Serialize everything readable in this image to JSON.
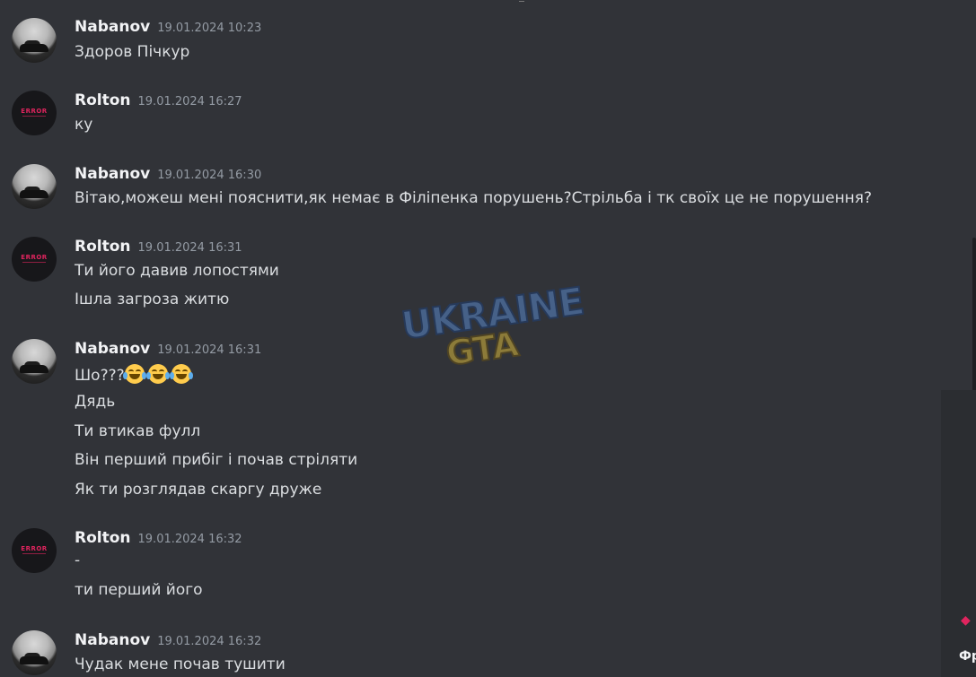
{
  "messages": [
    {
      "user": "Nabanov",
      "avatar": "car-photo",
      "time": "19.01.2024 10:23",
      "lines": [
        "Здоров Пічкур"
      ]
    },
    {
      "user": "Rolton",
      "avatar": "error-logo",
      "time": "19.01.2024 16:27",
      "lines": [
        "ку"
      ]
    },
    {
      "user": "Nabanov",
      "avatar": "car-photo",
      "time": "19.01.2024 16:30",
      "lines": [
        "Вітаю,можеш мені пояснити,як немає в Філіпенка порушень?Стрільба і тк своїх це не порушення?"
      ]
    },
    {
      "user": "Rolton",
      "avatar": "error-logo",
      "time": "19.01.2024 16:31",
      "lines": [
        "Ти його давив лопостями",
        "Ішла загроза житю"
      ]
    },
    {
      "user": "Nabanov",
      "avatar": "car-photo",
      "time": "19.01.2024 16:31",
      "lines": [
        "Шо???",
        "Дядь",
        "Ти втикав фулл",
        "Він перший прибіг і почав стріляти",
        "Як ти розглядав скаргу друже"
      ]
    },
    {
      "user": "Rolton",
      "avatar": "error-logo",
      "time": "19.01.2024 16:32",
      "lines": [
        "-",
        "ти перший його"
      ]
    },
    {
      "user": "Nabanov",
      "avatar": "car-photo",
      "time": "19.01.2024 16:32",
      "lines": [
        "Чудак мене почав тушити"
      ]
    }
  ],
  "rolton_avatar_text": "ERROR",
  "emoji": {
    "name": "joy-emoji",
    "count": 3
  },
  "watermark": {
    "line1": "UKRAINE",
    "line2": "GTA"
  },
  "side": {
    "label": "Фр"
  },
  "colors": {
    "background": "#313338",
    "username": "#f2f3f5",
    "timestamp": "#949ba4",
    "text": "#dbdee1"
  }
}
